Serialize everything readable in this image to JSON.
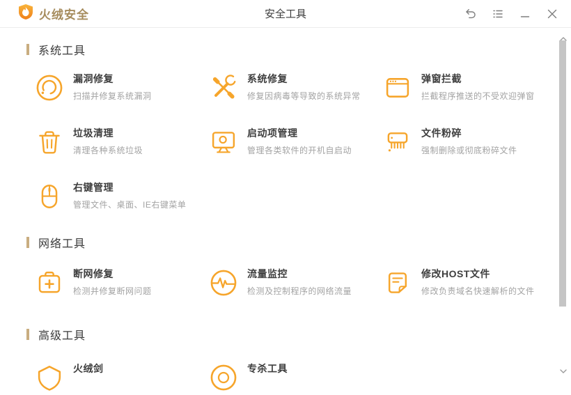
{
  "header": {
    "logo_text": "火绒安全",
    "title": "安全工具",
    "icons": [
      "brand-shield-flame-icon",
      "undo-arrow-icon",
      "list-menu-icon",
      "minimize-icon",
      "close-icon"
    ]
  },
  "scrollbar": {
    "icons": [
      "scroll-up-icon",
      "scroll-down-icon"
    ]
  },
  "colors": {
    "accent_orange": "#F6A52B",
    "logo_text": "#A68C5D",
    "section_bar": "#C9AD80",
    "item_title_text": "#3E3E3E",
    "item_desc_text": "#A3A3A3",
    "scrollbar_thumb": "#C5C5C5"
  },
  "sections": [
    {
      "title": "系统工具",
      "items": [
        {
          "icon": "vulnerability-fix-icon",
          "title": "漏洞修复",
          "desc": "扫描并修复系统漏洞"
        },
        {
          "icon": "system-repair-icon",
          "title": "系统修复",
          "desc": "修复因病毒等导致的系统异常"
        },
        {
          "icon": "popup-blocker-icon",
          "title": "弹窗拦截",
          "desc": "拦截程序推送的不受欢迎弹窗"
        },
        {
          "icon": "junk-clean-icon",
          "title": "垃圾清理",
          "desc": "清理各种系统垃圾"
        },
        {
          "icon": "startup-manager-icon",
          "title": "启动项管理",
          "desc": "管理各类软件的开机自启动"
        },
        {
          "icon": "file-shredder-icon",
          "title": "文件粉碎",
          "desc": "强制删除或彻底粉碎文件"
        },
        {
          "icon": "right-click-manager-icon",
          "title": "右键管理",
          "desc": "管理文件、桌面、IE右键菜单"
        }
      ]
    },
    {
      "title": "网络工具",
      "items": [
        {
          "icon": "network-repair-icon",
          "title": "断网修复",
          "desc": "检测并修复断网问题"
        },
        {
          "icon": "traffic-monitor-icon",
          "title": "流量监控",
          "desc": "检测及控制程序的网络流量"
        },
        {
          "icon": "host-file-icon",
          "title": "修改HOST文件",
          "desc": "修改负责域名快速解析的文件"
        }
      ]
    },
    {
      "title": "高级工具",
      "items": [
        {
          "icon": "huorong-sword-icon",
          "title": "火绒剑"
        },
        {
          "icon": "special-kill-icon",
          "title": "专杀工具"
        }
      ]
    }
  ]
}
